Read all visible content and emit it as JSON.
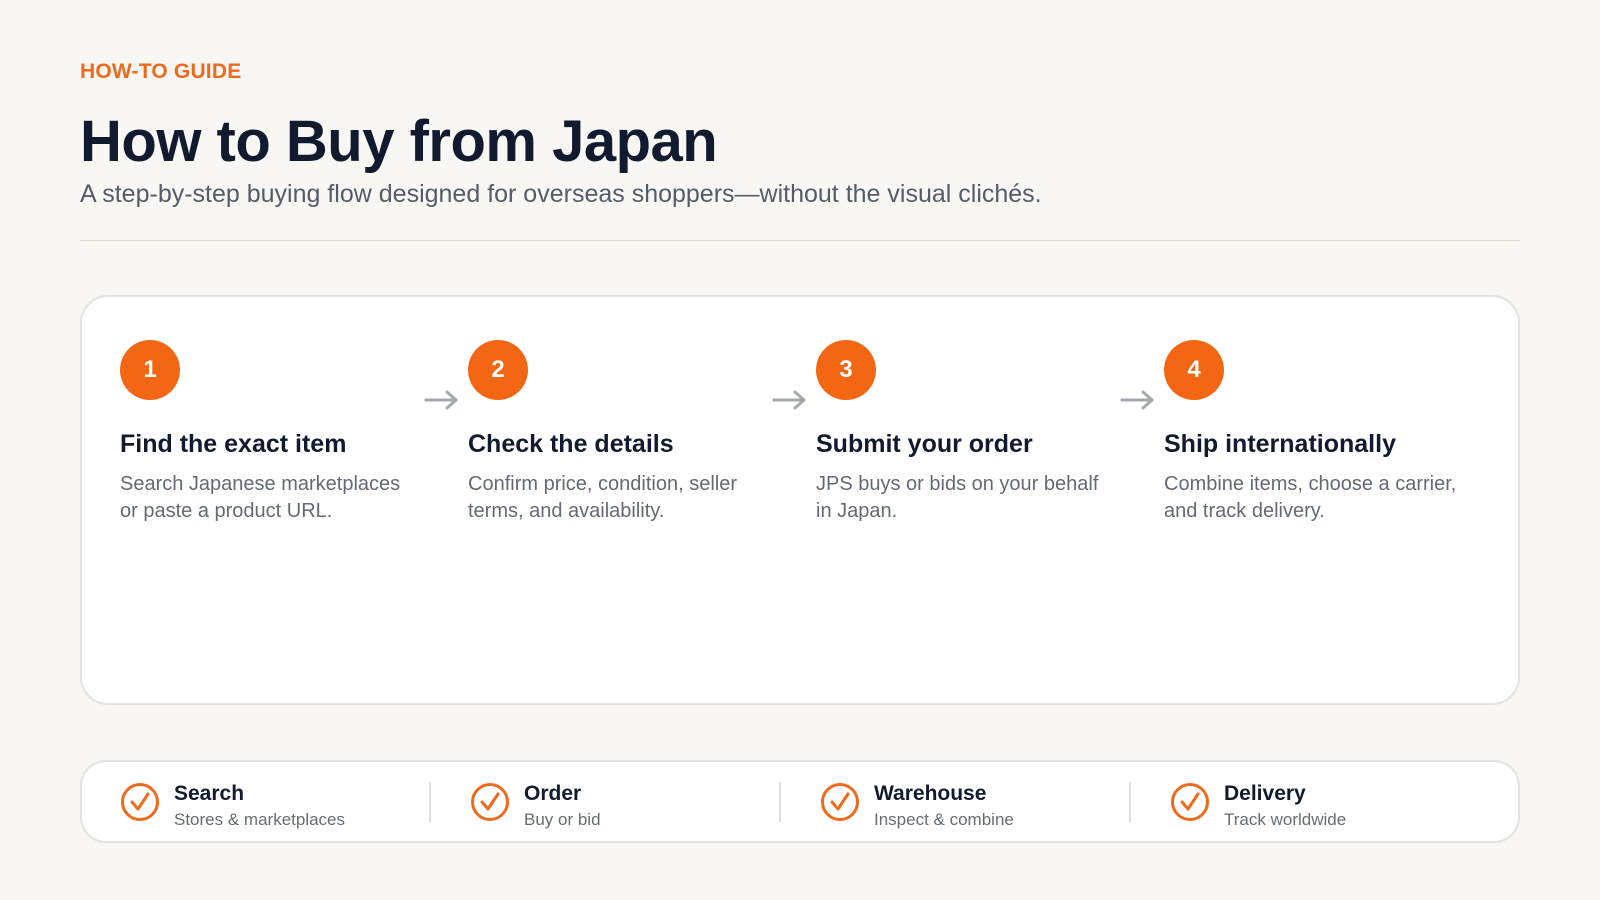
{
  "header": {
    "eyebrow": "HOW-TO GUIDE",
    "title": "How to Buy from Japan",
    "subtitle": "A step-by-step buying flow designed for overseas shoppers—without the visual clichés."
  },
  "steps": [
    {
      "number": "1",
      "title": "Find the exact item",
      "description": "Search Japanese marketplaces or paste a product URL."
    },
    {
      "number": "2",
      "title": "Check the details",
      "description": "Confirm price, condition, seller terms, and availability."
    },
    {
      "number": "3",
      "title": "Submit your order",
      "description": "JPS buys or bids on your behalf in Japan."
    },
    {
      "number": "4",
      "title": "Ship internationally",
      "description": "Combine items, choose a carrier, and track delivery."
    }
  ],
  "features": [
    {
      "title": "Search",
      "subtitle": "Stores & marketplaces",
      "icon": "check-circle-icon"
    },
    {
      "title": "Order",
      "subtitle": "Buy or bid",
      "icon": "check-circle-icon"
    },
    {
      "title": "Warehouse",
      "subtitle": "Inspect & combine",
      "icon": "check-circle-icon"
    },
    {
      "title": "Delivery",
      "subtitle": "Track worldwide",
      "icon": "check-circle-icon"
    }
  ],
  "colors": {
    "accent": "#f36714",
    "heading": "#111a2e",
    "body_text": "#636a75",
    "background": "#f8f7f4",
    "card": "#ffffff"
  }
}
